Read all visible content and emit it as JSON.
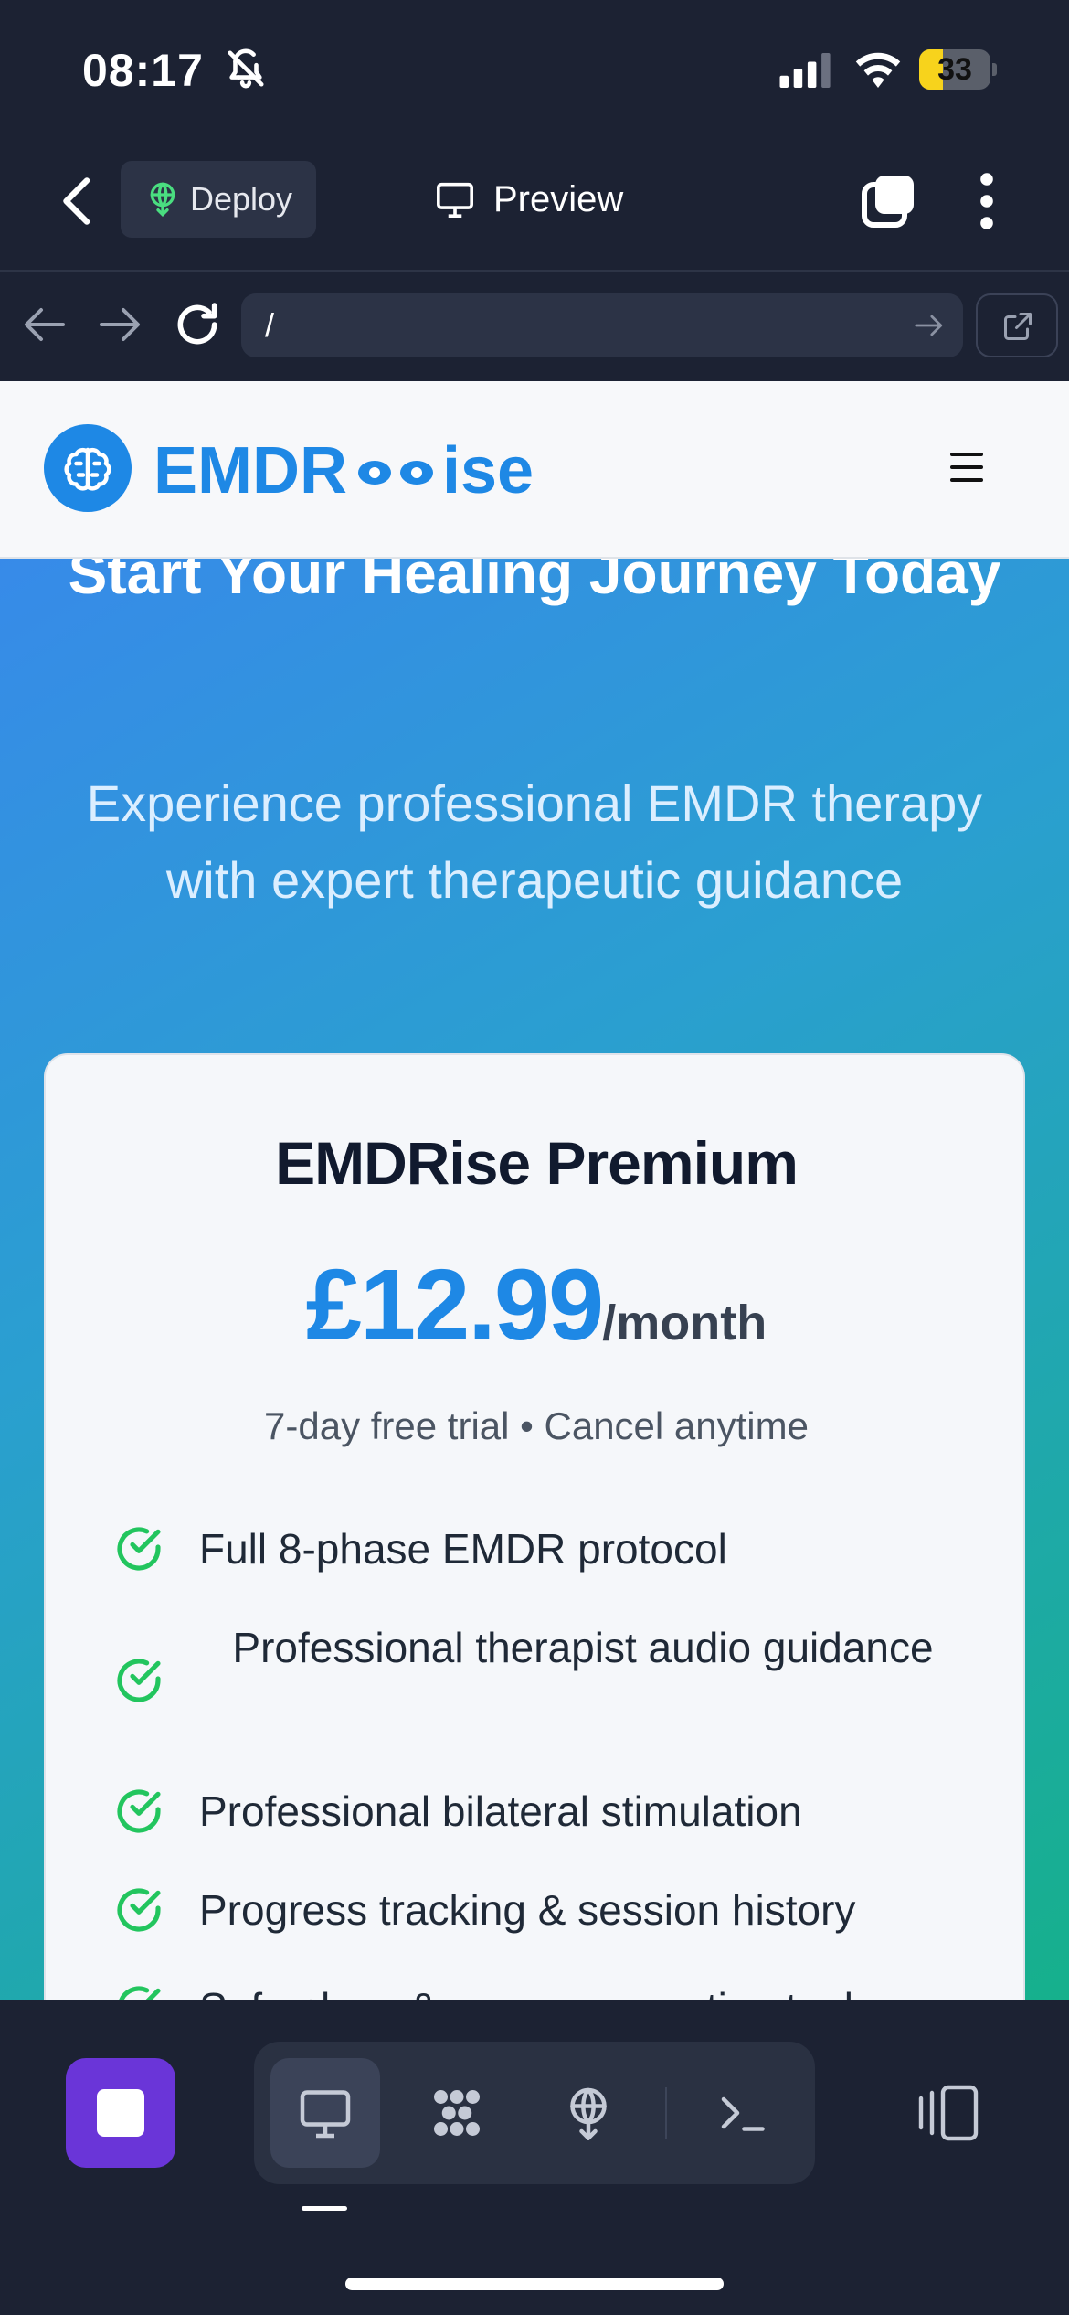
{
  "status_bar": {
    "time": "08:17",
    "battery_level": "33"
  },
  "top_bar": {
    "deploy_label": "Deploy",
    "preview_label": "Preview"
  },
  "browser_bar": {
    "url": "/"
  },
  "site": {
    "logo": {
      "text_left": "EMDR",
      "text_right": "ise",
      "color": "#1e88e5"
    },
    "hero": {
      "title": "Start Your Healing Journey Today",
      "subtitle": "Experience professional EMDR therapy with expert therapeutic guidance"
    },
    "plan": {
      "name": "EMDRise Premium",
      "price": "£12.99",
      "period": "/month",
      "trial": "7-day free trial • Cancel anytime",
      "features": [
        "Full 8-phase EMDR protocol",
        "Professional therapist audio guidance",
        "Professional bilateral stimulation",
        "Progress tracking & session history",
        "Safe place & resource creation tools"
      ]
    }
  },
  "colors": {
    "accent": "#1e88e5",
    "check": "#22c55e",
    "stop_button": "#6a35d8",
    "app_bg": "#1c2233"
  },
  "bottom_bar": {
    "tools": [
      "monitor-icon",
      "network-icon",
      "deploy-icon",
      "terminal-icon"
    ],
    "active_tool": "monitor-icon"
  }
}
